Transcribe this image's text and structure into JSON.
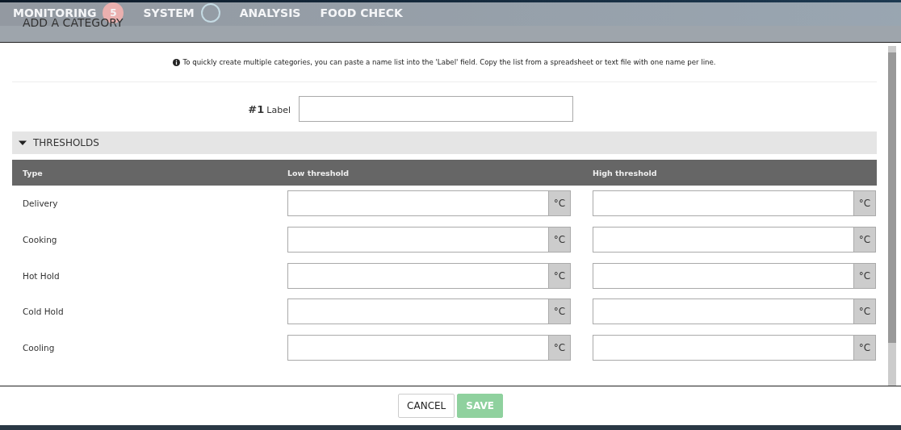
{
  "background": {
    "nav": [
      {
        "label": "MONITORING",
        "badge": "5",
        "kind": "badge"
      },
      {
        "label": "SYSTEM",
        "kind": "ring"
      },
      {
        "label": "ANALYSIS",
        "kind": "plain"
      },
      {
        "label": "FOOD CHECK",
        "kind": "plain"
      }
    ]
  },
  "dialog": {
    "title": "ADD A CATEGORY",
    "info": "To quickly create multiple categories, you can paste a name list into the 'Label' field. Copy the list from a spreadsheet or text file with one name per line.",
    "label_field": {
      "number": "#1",
      "label": "Label"
    },
    "section": {
      "title": "THRESHOLDS",
      "expanded": true
    },
    "table": {
      "columns": [
        "Type",
        "Low threshold",
        "High threshold"
      ],
      "rows": [
        {
          "type": "Delivery",
          "low_unit": "°C",
          "high_unit": "°C"
        },
        {
          "type": "Cooking",
          "low_unit": "°C",
          "high_unit": "°C"
        },
        {
          "type": "Hot Hold",
          "low_unit": "°C",
          "high_unit": "°C"
        },
        {
          "type": "Cold Hold",
          "low_unit": "°C",
          "high_unit": "°C"
        },
        {
          "type": "Cooling",
          "low_unit": "°C",
          "high_unit": "°C"
        }
      ]
    },
    "buttons": [
      {
        "label": "CANCEL",
        "kind": "secondary",
        "disabled": false
      },
      {
        "label": "SAVE",
        "kind": "primary",
        "disabled": true
      }
    ]
  }
}
